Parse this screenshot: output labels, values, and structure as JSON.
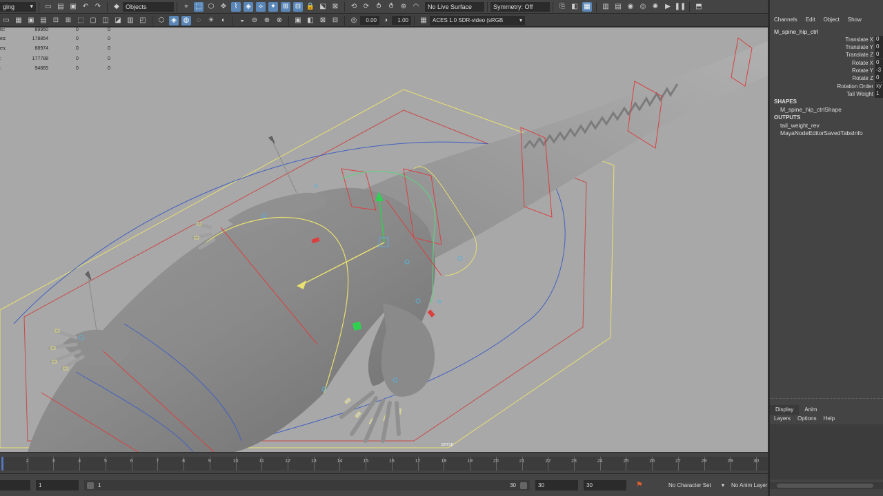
{
  "top_toolbar": {
    "menu_set": "ging",
    "select_mode": "Objects",
    "live_surface": "No Live Surface",
    "symmetry": "Symmetry: Off"
  },
  "view_toolbar": {
    "exposure": "0.00",
    "gamma": "1.00",
    "color_space": "ACES 1.0 SDR-video (sRGB"
  },
  "hud": {
    "rows": [
      {
        "label": "ts:",
        "v1": "89950",
        "v2": "0",
        "v3": "0"
      },
      {
        "label": "es:",
        "v1": "178854",
        "v2": "0",
        "v3": "0"
      },
      {
        "label": "es:",
        "v1": "88974",
        "v2": "0",
        "v3": "0"
      },
      {
        "label": ":",
        "v1": "177788",
        "v2": "0",
        "v3": "0"
      },
      {
        "label": ":",
        "v1": "94865",
        "v2": "0",
        "v3": "0"
      }
    ]
  },
  "viewport": {
    "camera_label": "persp",
    "background_color": "#a8a8a8"
  },
  "timeline": {
    "start": 1,
    "end": 30,
    "current": 1
  },
  "range_bar": {
    "start_field": "1",
    "playback_start": "1",
    "playback_end": "30",
    "end_field": "30",
    "anim_end": "30",
    "character_set": "No Character Set",
    "anim_layer": "No Anim Layer"
  },
  "channel_box": {
    "menu": [
      "Channels",
      "Edit",
      "Object",
      "Show"
    ],
    "node_name": "M_spine_hip_ctrl",
    "attributes": [
      {
        "label": "Translate X",
        "value": "0"
      },
      {
        "label": "Translate Y",
        "value": "0"
      },
      {
        "label": "Translate Z",
        "value": "0"
      },
      {
        "label": "Rotate X",
        "value": "0"
      },
      {
        "label": "Rotate Y",
        "value": "-3"
      },
      {
        "label": "Rotate Z",
        "value": "0"
      },
      {
        "label": "Rotation Order",
        "value": "xy"
      },
      {
        "label": "Tail Weight",
        "value": "1"
      }
    ],
    "shapes_header": "SHAPES",
    "shapes": [
      "M_spine_hip_ctrlShape"
    ],
    "outputs_header": "OUTPUTS",
    "outputs": [
      "tail_weight_rev",
      "MayaNodeEditorSavedTabsInfo"
    ]
  },
  "layer_editor": {
    "tabs": [
      "Display",
      "Anim"
    ],
    "menu": [
      "Layers",
      "Options",
      "Help"
    ]
  },
  "colors": {
    "accent": "#5a87b8",
    "ctrl_yellow": "#e8e070",
    "ctrl_red": "#d94040",
    "ctrl_blue": "#4060c0",
    "ctrl_cyan": "#5ab0d8",
    "ctrl_green": "#30d050"
  }
}
